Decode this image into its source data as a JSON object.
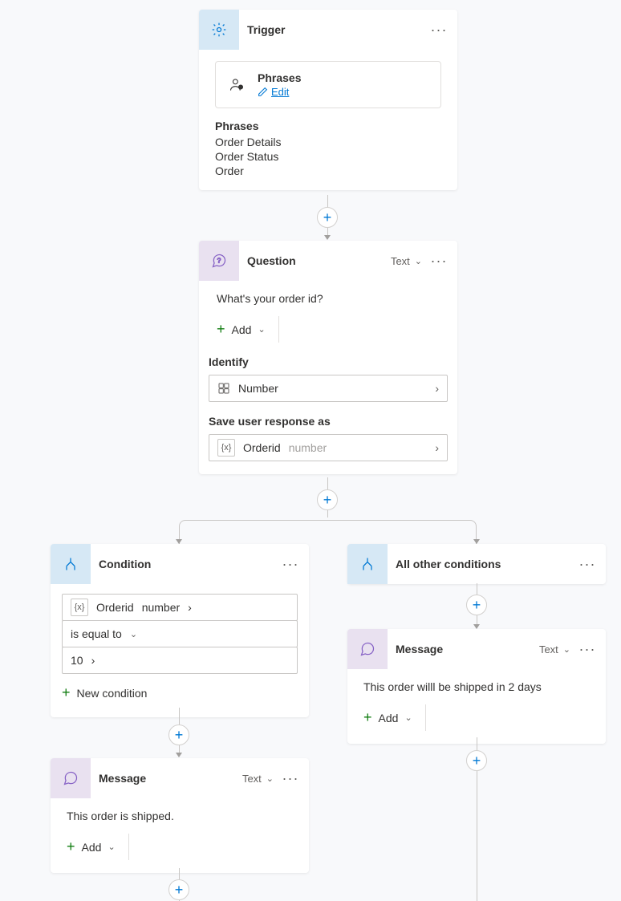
{
  "trigger": {
    "title": "Trigger",
    "box_label": "Phrases",
    "edit": "Edit",
    "list_label": "Phrases",
    "items": [
      "Order Details",
      "Order Status",
      "Order"
    ]
  },
  "question": {
    "title": "Question",
    "type": "Text",
    "prompt": "What's your order id?",
    "add": "Add",
    "identify_label": "Identify",
    "identify_value": "Number",
    "save_label": "Save user response as",
    "var_name": "Orderid",
    "var_type": "number"
  },
  "condition": {
    "title": "Condition",
    "var_name": "Orderid",
    "var_type": "number",
    "op": "is equal to",
    "value": "10",
    "new": "New condition"
  },
  "msg1": {
    "title": "Message",
    "type": "Text",
    "text": "This order is shipped.",
    "add": "Add"
  },
  "allother": {
    "title": "All other conditions"
  },
  "msg2": {
    "title": "Message",
    "type": "Text",
    "text": "This order willl be shipped in 2 days",
    "add": "Add"
  }
}
